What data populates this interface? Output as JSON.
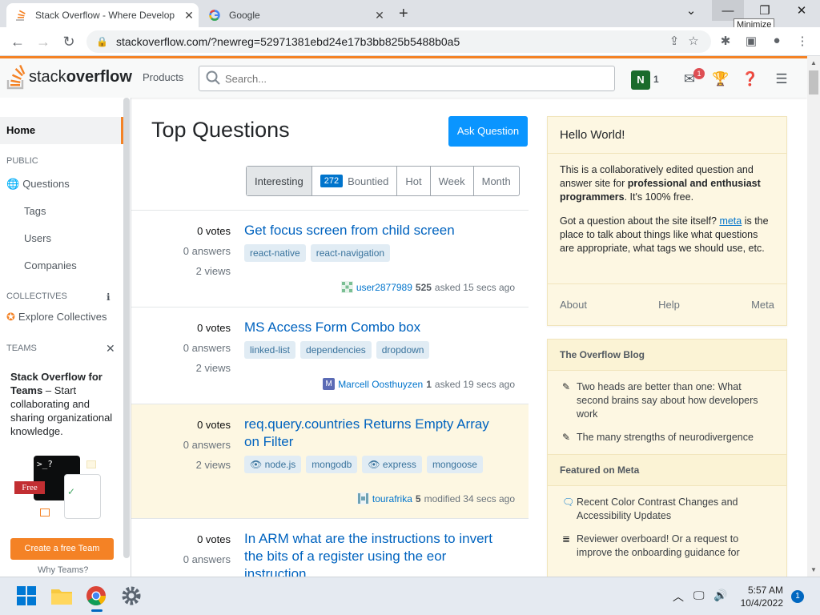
{
  "browser": {
    "tabs": [
      {
        "title": "Stack Overflow - Where Develop",
        "active": true
      },
      {
        "title": "Google",
        "active": false
      }
    ],
    "url": "stackoverflow.com/?newreg=52971381ebd24e17b3bb825b5488b0a5",
    "tooltip": "Minimize"
  },
  "so_header": {
    "logo_plain": "stack",
    "logo_bold": "overflow",
    "products": "Products",
    "search_placeholder": "Search...",
    "user_initial": "N",
    "reputation": "1",
    "inbox_count": "1"
  },
  "leftnav": {
    "home": "Home",
    "public_label": "PUBLIC",
    "items": [
      "Questions",
      "Tags",
      "Users",
      "Companies"
    ],
    "collectives_label": "COLLECTIVES",
    "explore": "Explore Collectives",
    "teams_label": "TEAMS",
    "teams_title": "Stack Overflow for Teams",
    "teams_desc": " – Start collaborating and sharing organizational knowledge.",
    "free_label": "Free",
    "cta": "Create a free Team",
    "why": "Why Teams?"
  },
  "main": {
    "title": "Top Questions",
    "ask": "Ask Question",
    "filters": [
      "Interesting",
      "Bountied",
      "Hot",
      "Week",
      "Month"
    ],
    "bountied_count": "272"
  },
  "questions": [
    {
      "votes": "0 votes",
      "answers": "0 answers",
      "views": "2 views",
      "title": "Get focus screen from child screen",
      "tags": [
        "react-native",
        "react-navigation"
      ],
      "user": "user2877989",
      "rep": "525",
      "time": "asked 15 secs ago"
    },
    {
      "votes": "0 votes",
      "answers": "0 answers",
      "views": "2 views",
      "title": "MS Access Form Combo box",
      "tags": [
        "linked-list",
        "dependencies",
        "dropdown"
      ],
      "user": "Marcell Oosthuyzen",
      "rep": "1",
      "time": "asked 19 secs ago",
      "avatar_letter": "M"
    },
    {
      "votes": "0 votes",
      "answers": "0 answers",
      "views": "2 views",
      "title": "req.query.countries Returns Empty Array on Filter",
      "tags": [
        "node.js",
        "mongodb",
        "express",
        "mongoose"
      ],
      "user": "tourafrika",
      "rep": "5",
      "time": "modified 34 secs ago"
    },
    {
      "votes": "0 votes",
      "answers": "0 answers",
      "title": "In ARM what are the instructions to invert the bits of a register using the eor instruction"
    }
  ],
  "sidebar": {
    "hello_title": "Hello World!",
    "hello_p1_a": "This is a collaboratively edited question and answer site for ",
    "hello_p1_b": "professional and enthusiast programmers",
    "hello_p1_c": ". It's 100% free.",
    "hello_p2_a": "Got a question about the site itself? ",
    "hello_p2_link": "meta",
    "hello_p2_b": " is the place to talk about things like what questions are appropriate, what tags we should use, etc.",
    "footer": [
      "About",
      "Help",
      "Meta"
    ],
    "blog_title": "The Overflow Blog",
    "blog_items": [
      "Two heads are better than one: What second brains say about how developers work",
      "The many strengths of neurodivergence"
    ],
    "meta_title": "Featured on Meta",
    "meta_items": [
      "Recent Color Contrast Changes and Accessibility Updates",
      "Reviewer overboard! Or a request to improve the onboarding guidance for"
    ]
  },
  "taskbar": {
    "time": "5:57 AM",
    "date": "10/4/2022",
    "notifications": "1"
  },
  "colors": {
    "accent": "#f48225",
    "link": "#0063bf",
    "ask_button": "#0a95ff",
    "highlight_row": "#fdf7e2"
  }
}
